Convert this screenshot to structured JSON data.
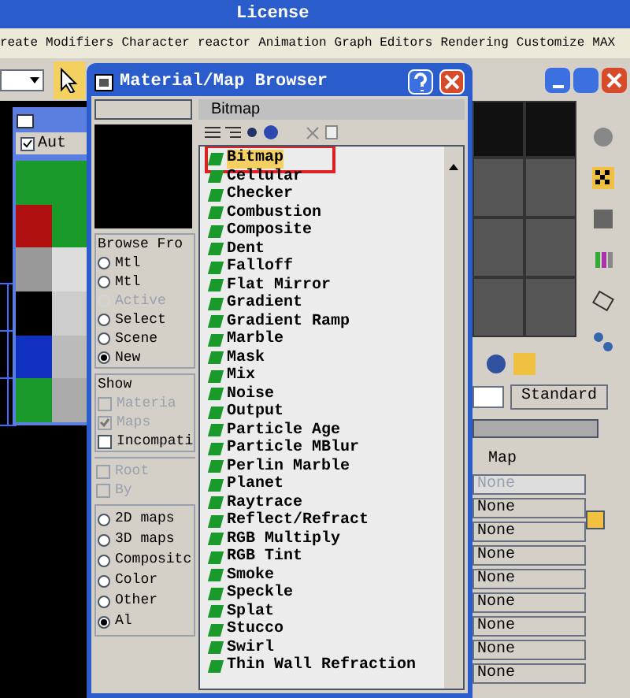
{
  "app": {
    "title": "License",
    "menu": [
      "reate",
      "Modifiers",
      "Character",
      "reactor",
      "Animation",
      "Graph Editors",
      "Rendering",
      "Customize",
      "MAX"
    ]
  },
  "small_window": {
    "checkbox": {
      "label": "Aut",
      "checked": true
    }
  },
  "browser": {
    "title": "Material/Map Browser",
    "selected_name": "Bitmap",
    "browse_from": {
      "title": "Browse Fro",
      "options": [
        {
          "label": "Mtl",
          "selected": false,
          "disabled": false
        },
        {
          "label": "Mtl",
          "selected": false,
          "disabled": false
        },
        {
          "label": "Active",
          "selected": false,
          "disabled": true
        },
        {
          "label": "Select",
          "selected": false,
          "disabled": false
        },
        {
          "label": "Scene",
          "selected": false,
          "disabled": false
        },
        {
          "label": "New",
          "selected": true,
          "disabled": false
        }
      ]
    },
    "show": {
      "title": "Show",
      "options": [
        {
          "label": "Materia",
          "checked": false,
          "disabled": true
        },
        {
          "label": "Maps",
          "checked": true,
          "disabled": true
        },
        {
          "label": "Incompati",
          "checked": false,
          "disabled": false
        }
      ]
    },
    "extra": [
      {
        "label": "Root",
        "checked": false,
        "disabled": true
      },
      {
        "label": "By",
        "checked": false,
        "disabled": true
      }
    ],
    "categories": [
      {
        "label": "2D maps",
        "selected": false
      },
      {
        "label": "3D maps",
        "selected": false
      },
      {
        "label": "Compositc",
        "selected": false
      },
      {
        "label": "Color",
        "selected": false
      },
      {
        "label": "Other",
        "selected": false
      },
      {
        "label": "Al",
        "selected": true
      }
    ],
    "items": [
      {
        "label": "Bitmap",
        "selected": true
      },
      {
        "label": "Cellular",
        "selected": false
      },
      {
        "label": "Checker",
        "selected": false
      },
      {
        "label": "Combustion",
        "selected": false
      },
      {
        "label": "Composite",
        "selected": false
      },
      {
        "label": "Dent",
        "selected": false
      },
      {
        "label": "Falloff",
        "selected": false
      },
      {
        "label": "Flat Mirror",
        "selected": false
      },
      {
        "label": "Gradient",
        "selected": false
      },
      {
        "label": "Gradient Ramp",
        "selected": false
      },
      {
        "label": "Marble",
        "selected": false
      },
      {
        "label": "Mask",
        "selected": false
      },
      {
        "label": "Mix",
        "selected": false
      },
      {
        "label": "Noise",
        "selected": false
      },
      {
        "label": "Output",
        "selected": false
      },
      {
        "label": "Particle Age",
        "selected": false
      },
      {
        "label": "Particle MBlur",
        "selected": false
      },
      {
        "label": "Perlin Marble",
        "selected": false
      },
      {
        "label": "Planet",
        "selected": false
      },
      {
        "label": "Raytrace",
        "selected": false
      },
      {
        "label": "Reflect/Refract",
        "selected": false
      },
      {
        "label": "RGB Multiply",
        "selected": false
      },
      {
        "label": "RGB Tint",
        "selected": false
      },
      {
        "label": "Smoke",
        "selected": false
      },
      {
        "label": "Speckle",
        "selected": false
      },
      {
        "label": "Splat",
        "selected": false
      },
      {
        "label": "Stucco",
        "selected": false
      },
      {
        "label": "Swirl",
        "selected": false
      },
      {
        "label": "Thin Wall Refraction",
        "selected": false
      }
    ]
  },
  "editor": {
    "type_button": "Standard",
    "map_header": "Map",
    "maps": [
      {
        "label": "None",
        "disabled": true
      },
      {
        "label": "None",
        "disabled": false
      },
      {
        "label": "None",
        "disabled": false
      },
      {
        "label": "None",
        "disabled": false
      },
      {
        "label": "None",
        "disabled": false
      },
      {
        "label": "None",
        "disabled": false
      },
      {
        "label": "None",
        "disabled": false
      },
      {
        "label": "None",
        "disabled": false
      },
      {
        "label": "None",
        "disabled": false
      }
    ]
  }
}
